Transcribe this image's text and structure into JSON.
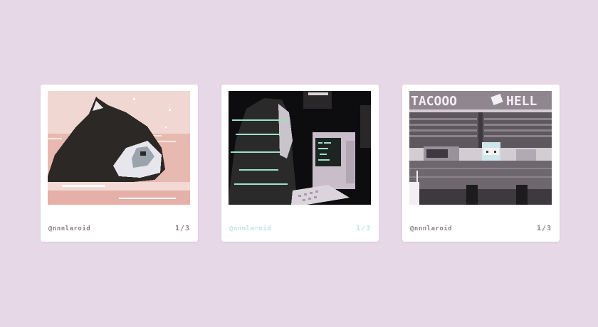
{
  "colors": {
    "background": "#e6d8e6",
    "card": "#ffffff",
    "caption_default": "#8a7f86",
    "caption_active": "#bfe3ea"
  },
  "cards": [
    {
      "caption": "@nnnlaroid",
      "counter": "1/3",
      "scene": "black cat sleeping on pink sea",
      "active": false
    },
    {
      "caption": "@nnnlaroid",
      "counter": "1/3",
      "scene": "hooded figure at retro computer",
      "active": true
    },
    {
      "caption": "@nnnlaroid",
      "counter": "1/3",
      "scene": "taco shop counter",
      "active": false
    }
  ],
  "scene3": {
    "sign_text": "TACOOO",
    "sign_text_2": "HELL"
  }
}
